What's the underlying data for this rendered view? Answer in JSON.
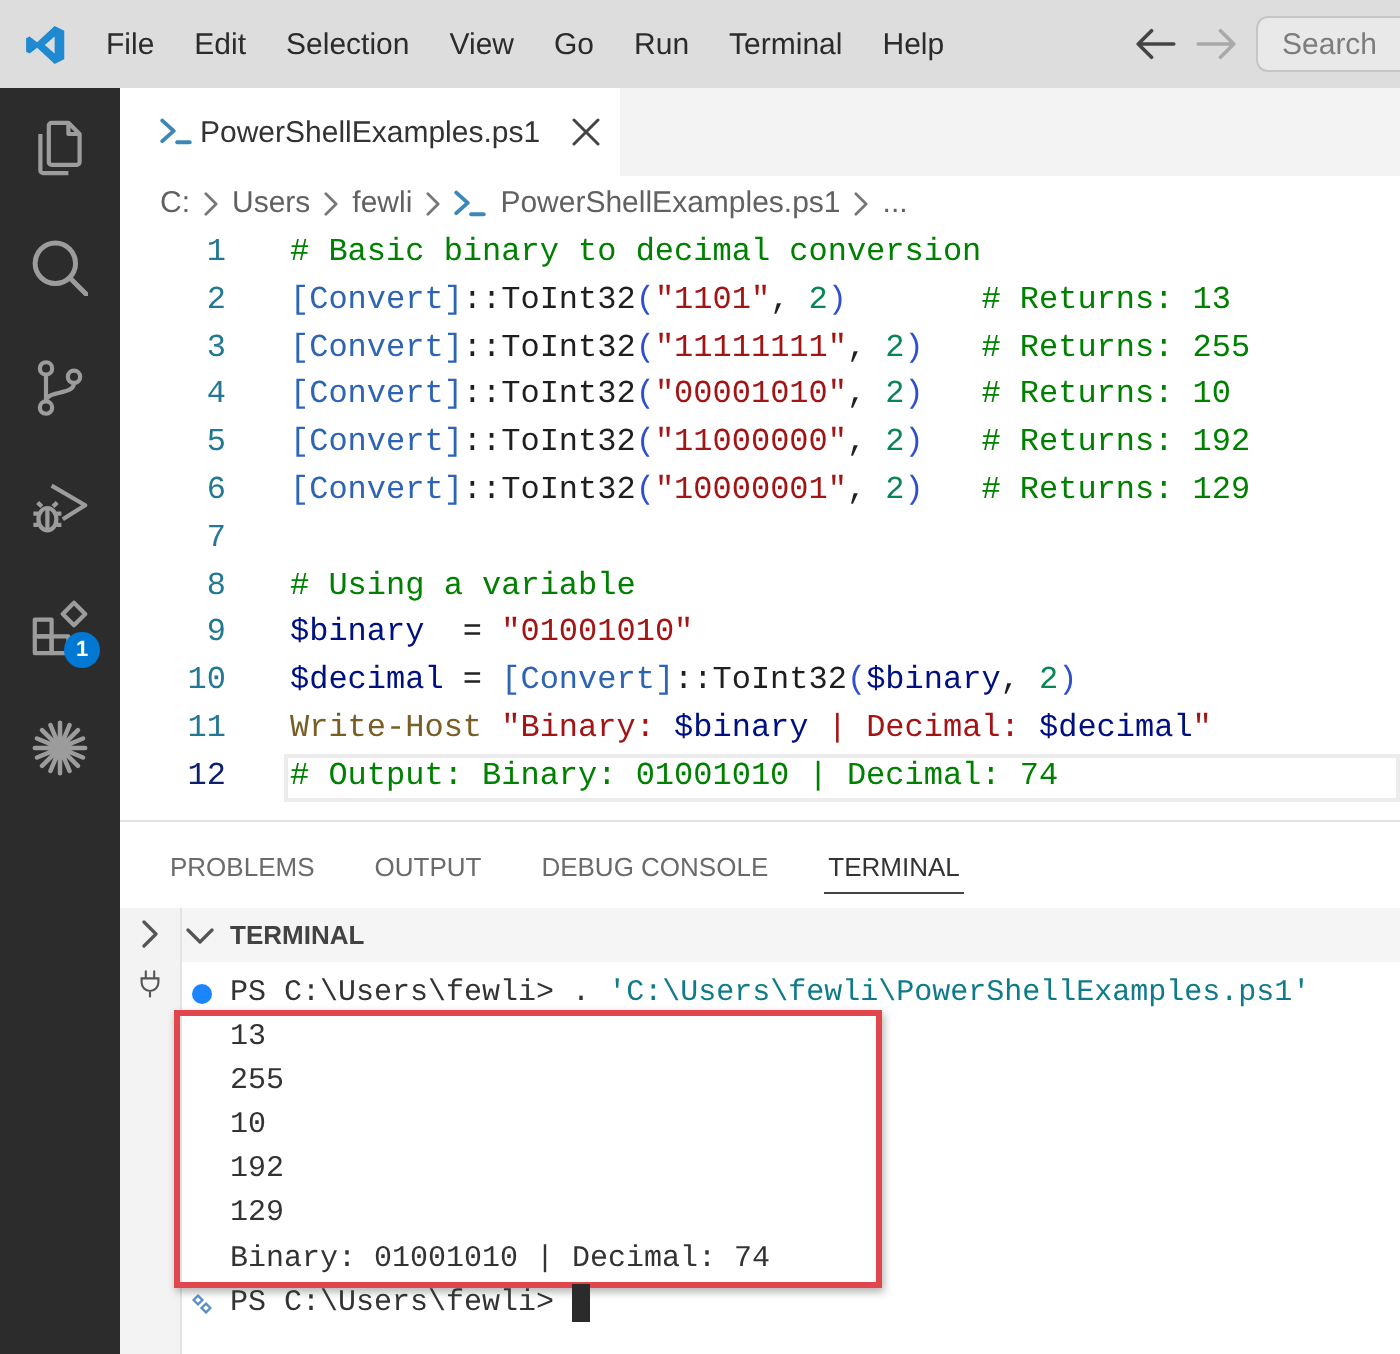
{
  "menu_bar": {
    "items": [
      "File",
      "Edit",
      "Selection",
      "View",
      "Go",
      "Run",
      "Terminal",
      "Help"
    ],
    "search": {
      "placeholder": "Search"
    }
  },
  "nav_buttons": [
    {
      "kind": "back",
      "disabled": false
    },
    {
      "kind": "forward",
      "disabled": true
    }
  ],
  "activity_bar": {
    "badge": "1"
  },
  "tabs": [
    {
      "label": "PowerShellExamples.ps1",
      "selected": true
    }
  ],
  "breadcrumb": [
    {
      "kind": "folder",
      "label": "C:"
    },
    {
      "kind": "folder",
      "label": "Users"
    },
    {
      "kind": "folder",
      "label": "fewli"
    },
    {
      "kind": "file",
      "label": "PowerShellExamples.ps1"
    },
    {
      "kind": "more",
      "label": "..."
    }
  ],
  "editor": {
    "lines": [
      {
        "number": "1",
        "current": false,
        "tokens": [
          {
            "kind": "comment",
            "text": "# Basic binary to decimal conversion"
          }
        ]
      },
      {
        "number": "2",
        "current": false,
        "tokens": [
          {
            "kind": "type",
            "text": "[Convert]"
          },
          {
            "kind": "plain",
            "text": "::ToInt32"
          },
          {
            "kind": "bracket",
            "text": "("
          },
          {
            "kind": "string",
            "text": "\"1101\""
          },
          {
            "kind": "plain",
            "text": ", "
          },
          {
            "kind": "number",
            "text": "2"
          },
          {
            "kind": "bracket",
            "text": ")       "
          },
          {
            "kind": "comment",
            "text": "# Returns: 13"
          }
        ]
      },
      {
        "number": "3",
        "current": false,
        "tokens": [
          {
            "kind": "type",
            "text": "[Convert]"
          },
          {
            "kind": "plain",
            "text": "::ToInt32"
          },
          {
            "kind": "bracket",
            "text": "("
          },
          {
            "kind": "string",
            "text": "\"11111111\""
          },
          {
            "kind": "plain",
            "text": ", "
          },
          {
            "kind": "number",
            "text": "2"
          },
          {
            "kind": "bracket",
            "text": ")   "
          },
          {
            "kind": "comment",
            "text": "# Returns: 255"
          }
        ]
      },
      {
        "number": "4",
        "current": false,
        "tokens": [
          {
            "kind": "type",
            "text": "[Convert]"
          },
          {
            "kind": "plain",
            "text": "::ToInt32"
          },
          {
            "kind": "bracket",
            "text": "("
          },
          {
            "kind": "string",
            "text": "\"00001010\""
          },
          {
            "kind": "plain",
            "text": ", "
          },
          {
            "kind": "number",
            "text": "2"
          },
          {
            "kind": "bracket",
            "text": ")   "
          },
          {
            "kind": "comment",
            "text": "# Returns: 10"
          }
        ]
      },
      {
        "number": "5",
        "current": false,
        "tokens": [
          {
            "kind": "type",
            "text": "[Convert]"
          },
          {
            "kind": "plain",
            "text": "::ToInt32"
          },
          {
            "kind": "bracket",
            "text": "("
          },
          {
            "kind": "string",
            "text": "\"11000000\""
          },
          {
            "kind": "plain",
            "text": ", "
          },
          {
            "kind": "number",
            "text": "2"
          },
          {
            "kind": "bracket",
            "text": ")   "
          },
          {
            "kind": "comment",
            "text": "# Returns: 192"
          }
        ]
      },
      {
        "number": "6",
        "current": false,
        "tokens": [
          {
            "kind": "type",
            "text": "[Convert]"
          },
          {
            "kind": "plain",
            "text": "::ToInt32"
          },
          {
            "kind": "bracket",
            "text": "("
          },
          {
            "kind": "string",
            "text": "\"10000001\""
          },
          {
            "kind": "plain",
            "text": ", "
          },
          {
            "kind": "number",
            "text": "2"
          },
          {
            "kind": "bracket",
            "text": ")   "
          },
          {
            "kind": "comment",
            "text": "# Returns: 129"
          }
        ]
      },
      {
        "number": "7",
        "current": false
      },
      {
        "number": "8",
        "current": false,
        "tokens": [
          {
            "kind": "comment",
            "text": "# Using a variable"
          }
        ]
      },
      {
        "number": "9",
        "current": false,
        "tokens": [
          {
            "kind": "variable",
            "text": "$binary"
          },
          {
            "kind": "plain",
            "text": "  = "
          },
          {
            "kind": "string",
            "text": "\"01001010\""
          }
        ]
      },
      {
        "number": "10",
        "current": false,
        "tokens": [
          {
            "kind": "variable",
            "text": "$decimal"
          },
          {
            "kind": "plain",
            "text": " = "
          },
          {
            "kind": "type",
            "text": "[Convert]"
          },
          {
            "kind": "plain",
            "text": "::ToInt32"
          },
          {
            "kind": "bracket",
            "text": "("
          },
          {
            "kind": "variable",
            "text": "$binary"
          },
          {
            "kind": "plain",
            "text": ", "
          },
          {
            "kind": "number",
            "text": "2"
          },
          {
            "kind": "bracket",
            "text": ")"
          }
        ]
      },
      {
        "number": "11",
        "current": false,
        "tokens": [
          {
            "kind": "command",
            "text": "Write-Host "
          },
          {
            "kind": "string",
            "text": "\"Binary: "
          },
          {
            "kind": "variable",
            "text": "$binary"
          },
          {
            "kind": "string",
            "text": " | Decimal: "
          },
          {
            "kind": "variable",
            "text": "$decimal"
          },
          {
            "kind": "string",
            "text": "\""
          }
        ]
      },
      {
        "number": "12",
        "current": true,
        "tokens": [
          {
            "kind": "comment",
            "text": "# Output: Binary: 01001010 | Decimal: 74"
          }
        ]
      }
    ]
  },
  "panel": {
    "tabs": [
      {
        "label": "PROBLEMS",
        "selected": false
      },
      {
        "label": "OUTPUT",
        "selected": false
      },
      {
        "label": "DEBUG CONSOLE",
        "selected": false
      },
      {
        "label": "TERMINAL",
        "selected": true
      }
    ],
    "section": {
      "title": "TERMINAL",
      "expanded": true
    },
    "terminal": {
      "lines": [
        {
          "kind": "command",
          "prompt": "PS C:\\Users\\fewli>",
          "command": ".",
          "argument": "'C:\\Users\\fewli\\PowerShellExamples.ps1'",
          "highlighted": false
        },
        {
          "kind": "output",
          "text": "13",
          "highlighted": true
        },
        {
          "kind": "output",
          "text": "255",
          "highlighted": true
        },
        {
          "kind": "output",
          "text": "10",
          "highlighted": true
        },
        {
          "kind": "output",
          "text": "192",
          "highlighted": true
        },
        {
          "kind": "output",
          "text": "129",
          "highlighted": true
        },
        {
          "kind": "output",
          "text": "Binary: 01001010 | Decimal: 74",
          "highlighted": true
        },
        {
          "kind": "prompt",
          "prompt": "PS C:\\Users\\fewli>",
          "highlighted": false
        }
      ]
    }
  }
}
